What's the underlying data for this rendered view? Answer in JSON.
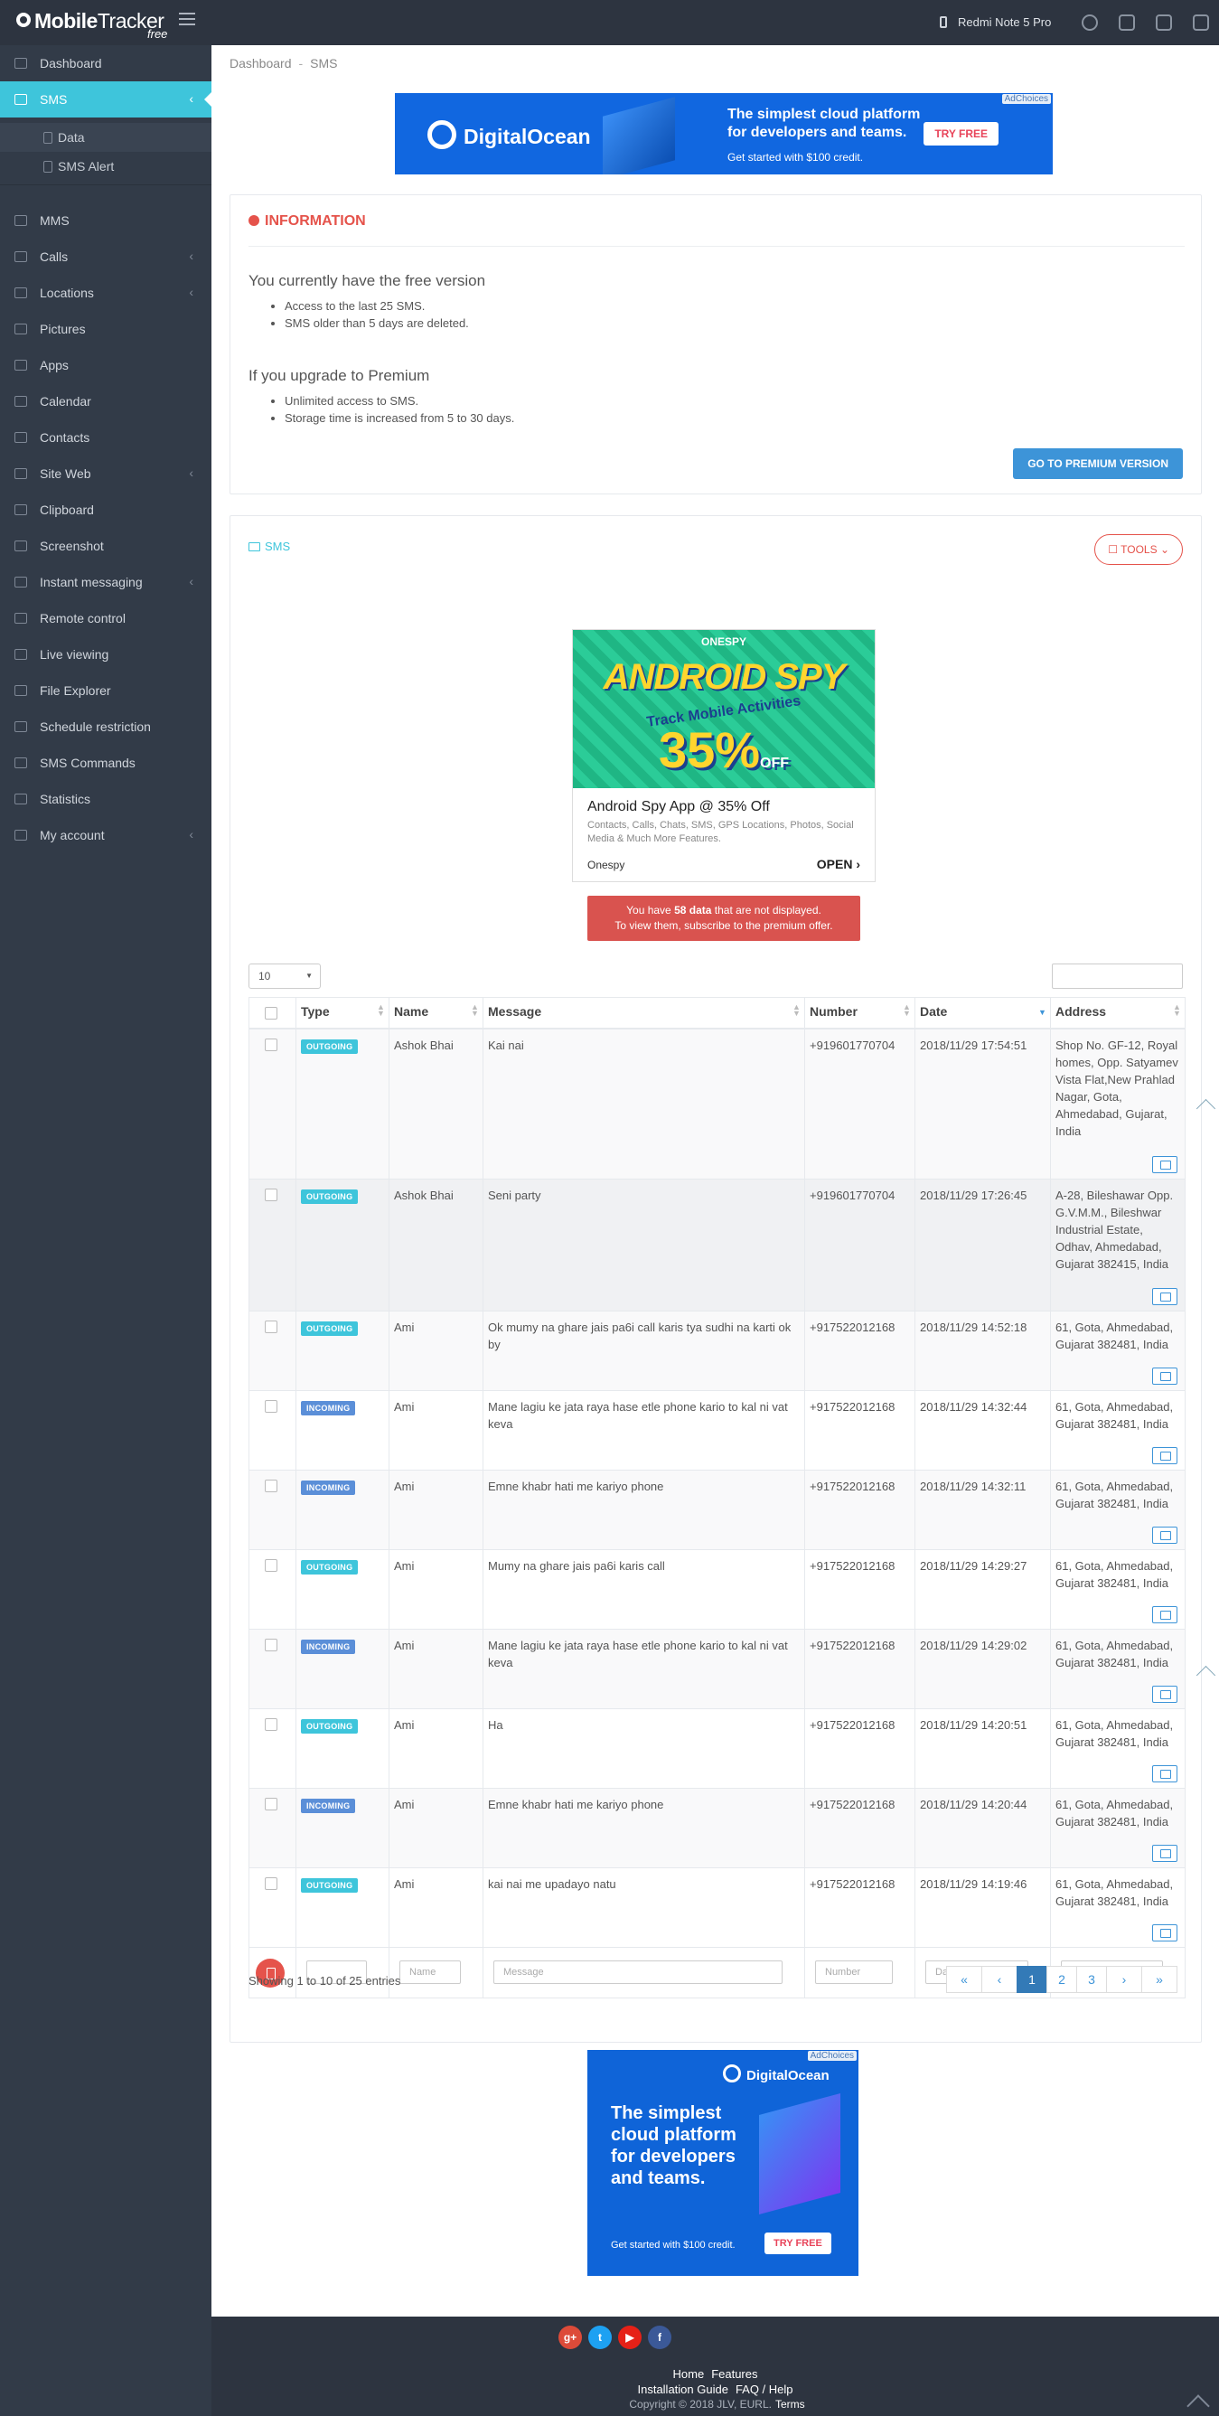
{
  "app": {
    "name_bold": "Mobile",
    "name_light": "Tracker",
    "edition": "free"
  },
  "topbar": {
    "device": "Redmi Note 5 Pro",
    "icons": [
      "phone-icon",
      "user-icon",
      "gear-icon",
      "store-icon",
      "logout-icon"
    ]
  },
  "sidebar": {
    "items": [
      {
        "label": "Dashboard",
        "icon": "home-icon"
      },
      {
        "label": "SMS",
        "icon": "envelope-icon",
        "active": true
      },
      {
        "label": "MMS",
        "icon": "image-icon"
      },
      {
        "label": "Calls",
        "icon": "phone-icon",
        "chevron": true
      },
      {
        "label": "Locations",
        "icon": "map-icon",
        "chevron": true
      },
      {
        "label": "Pictures",
        "icon": "picture-icon"
      },
      {
        "label": "Apps",
        "icon": "apps-icon"
      },
      {
        "label": "Calendar",
        "icon": "calendar-icon"
      },
      {
        "label": "Contacts",
        "icon": "contacts-icon"
      },
      {
        "label": "Site Web",
        "icon": "globe-icon",
        "chevron": true
      },
      {
        "label": "Clipboard",
        "icon": "clipboard-icon"
      },
      {
        "label": "Screenshot",
        "icon": "binoculars-icon"
      },
      {
        "label": "Instant messaging",
        "icon": "eye-icon",
        "chevron": true
      },
      {
        "label": "Remote control",
        "icon": "remote-icon"
      },
      {
        "label": "Live viewing",
        "icon": "video-icon"
      },
      {
        "label": "File Explorer",
        "icon": "folder-icon"
      },
      {
        "label": "Schedule restriction",
        "icon": "lock-icon"
      },
      {
        "label": "SMS Commands",
        "icon": "send-icon"
      },
      {
        "label": "Statistics",
        "icon": "chart-icon"
      },
      {
        "label": "My account",
        "icon": "user-icon",
        "chevron": true
      }
    ],
    "subitems": [
      {
        "label": "Data",
        "icon": "document-icon"
      },
      {
        "label": "SMS Alert",
        "icon": "bell-icon"
      }
    ]
  },
  "breadcrumb": {
    "home": "Dashboard",
    "sep": "-",
    "current": "SMS"
  },
  "ads": {
    "top": {
      "choices": "AdChoices",
      "brand": "DigitalOcean",
      "headline": "The simplest cloud platform for developers and teams.",
      "sub": "Get started with $100 credit.",
      "cta": "TRY FREE"
    },
    "middle": {
      "logo": "ONESPY",
      "big1": "ANDROID SPY",
      "big2": "Track Mobile Activities",
      "big3": "35%",
      "off": "OFF",
      "headline": "Android Spy App @ 35% Off",
      "desc": "Contacts, Calls, Chats, SMS, GPS Locations, Photos, Social Media & Much More Features.",
      "advertiser": "Onespy",
      "cta": "OPEN"
    },
    "bottom": {
      "choices": "AdChoices",
      "brand": "DigitalOcean",
      "headline": "The simplest cloud platform for developers and teams.",
      "sub": "Get started with $100 credit.",
      "cta": "TRY FREE"
    }
  },
  "info": {
    "title": "INFORMATION",
    "free_heading": "You currently have the free version",
    "free_points": [
      "Access to the last 25 SMS.",
      "SMS older than 5 days are deleted."
    ],
    "premium_heading": "If you upgrade to Premium",
    "premium_points": [
      "Unlimited access to SMS.",
      "Storage time is increased from 5 to 30 days."
    ],
    "button": "GO TO PREMIUM VERSION"
  },
  "sms": {
    "title": "SMS",
    "tools": "TOOLS",
    "notice_pre": "You have ",
    "notice_count": "58 data",
    "notice_post": " that are not displayed.",
    "notice_line2": "To view them, subscribe to the premium offer.",
    "page_length": "10",
    "columns": [
      "Type",
      "Name",
      "Message",
      "Number",
      "Date",
      "Address"
    ],
    "rows": [
      {
        "type": "OUTGOING",
        "name": "Ashok Bhai",
        "message": "Kai nai",
        "number": "+919601770704",
        "date": "2018/11/29 17:54:51",
        "address": "Shop No. GF-12, Royal homes, Opp. Satyamev Vista Flat,New Prahlad Nagar, Gota, Ahmedabad, Gujarat, India"
      },
      {
        "type": "OUTGOING",
        "name": "Ashok Bhai",
        "message": "Seni party",
        "number": "+919601770704",
        "date": "2018/11/29 17:26:45",
        "address": "A-28, Bileshawar Opp. G.V.M.M., Bileshwar Industrial Estate, Odhav, Ahmedabad, Gujarat 382415, India"
      },
      {
        "type": "OUTGOING",
        "name": "Ami",
        "message": "Ok mumy na ghare jais pa6i call karis tya sudhi na karti ok by",
        "number": "+917522012168",
        "date": "2018/11/29 14:52:18",
        "address": "61, Gota, Ahmedabad, Gujarat 382481, India"
      },
      {
        "type": "INCOMING",
        "name": "Ami",
        "message": "Mane lagiu ke jata raya hase etle phone kario to kal ni vat keva",
        "number": "+917522012168",
        "date": "2018/11/29 14:32:44",
        "address": "61, Gota, Ahmedabad, Gujarat 382481, India"
      },
      {
        "type": "INCOMING",
        "name": "Ami",
        "message": "Emne khabr hati me kariyo phone",
        "number": "+917522012168",
        "date": "2018/11/29 14:32:11",
        "address": "61, Gota, Ahmedabad, Gujarat 382481, India"
      },
      {
        "type": "OUTGOING",
        "name": "Ami",
        "message": "Mumy na ghare jais pa6i karis call",
        "number": "+917522012168",
        "date": "2018/11/29 14:29:27",
        "address": "61, Gota, Ahmedabad, Gujarat 382481, India"
      },
      {
        "type": "INCOMING",
        "name": "Ami",
        "message": "Mane lagiu ke jata raya hase etle phone kario to kal ni vat keva",
        "number": "+917522012168",
        "date": "2018/11/29 14:29:02",
        "address": "61, Gota, Ahmedabad, Gujarat 382481, India"
      },
      {
        "type": "OUTGOING",
        "name": "Ami",
        "message": "Ha",
        "number": "+917522012168",
        "date": "2018/11/29 14:20:51",
        "address": "61, Gota, Ahmedabad, Gujarat 382481, India"
      },
      {
        "type": "INCOMING",
        "name": "Ami",
        "message": "Emne khabr hati me kariyo phone",
        "number": "+917522012168",
        "date": "2018/11/29 14:20:44",
        "address": "61, Gota, Ahmedabad, Gujarat 382481, India"
      },
      {
        "type": "OUTGOING",
        "name": "Ami",
        "message": "kai nai me upadayo natu",
        "number": "+917522012168",
        "date": "2018/11/29 14:19:46",
        "address": "61, Gota, Ahmedabad, Gujarat 382481, India"
      }
    ],
    "filters": {
      "type": "",
      "name": "Name",
      "message": "Message",
      "number": "Number",
      "date": "Date",
      "address": "Address"
    },
    "showing": "Showing 1 to 10 of 25 entries",
    "pages": [
      "«",
      "‹",
      "1",
      "2",
      "3",
      "›",
      "»"
    ],
    "current_page": "1"
  },
  "footer": {
    "social": [
      "g+",
      "t",
      "▶",
      "f"
    ],
    "links1": [
      "Home",
      "Features"
    ],
    "links2": [
      "Installation Guide",
      "FAQ / Help"
    ],
    "copyright": "Copyright © 2018 JLV, EURL.",
    "terms": "Terms"
  }
}
